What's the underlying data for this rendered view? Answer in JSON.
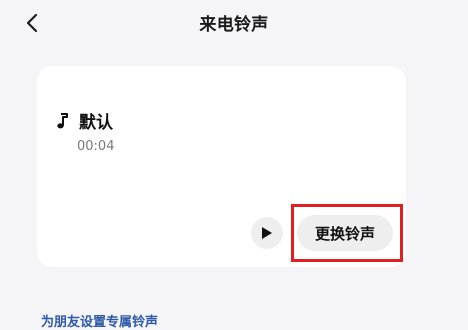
{
  "header": {
    "title": "来电铃声"
  },
  "ringtone": {
    "name": "默认",
    "duration": "00:04"
  },
  "actions": {
    "change_label": "更换铃声"
  },
  "footer": {
    "set_for_friends": "为朋友设置专属铃声"
  },
  "icons": {
    "back": "back-icon",
    "note": "music-note-icon",
    "play": "play-icon"
  },
  "colors": {
    "background": "#f5f5f7",
    "card": "#ffffff",
    "button_bg": "#eeeeee",
    "link": "#2f5aa6",
    "highlight": "#e02020"
  }
}
